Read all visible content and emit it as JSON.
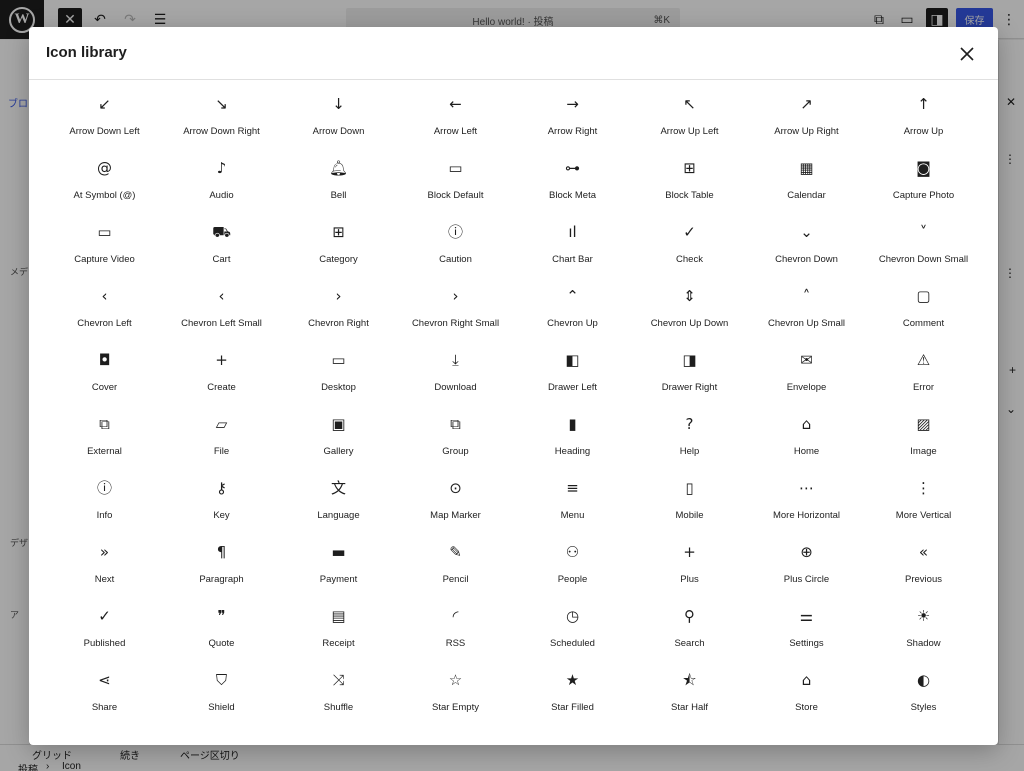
{
  "editor": {
    "wp_logo": "W",
    "doc_title": "Hello world! · 投稿",
    "shortcut": "⌘K",
    "save_label": "保存",
    "left_tab": "ブロ",
    "left_labels": [
      "メデ",
      "デザ",
      "ア"
    ],
    "bottom_tabs": [
      "グリッド",
      "続き",
      "ページ区切り"
    ],
    "breadcrumb": [
      "投稿",
      "›",
      "Icon"
    ]
  },
  "modal": {
    "title": "Icon library",
    "icons": [
      {
        "label": "Arrow Down Left",
        "glyph": "↙"
      },
      {
        "label": "Arrow Down Right",
        "glyph": "↘"
      },
      {
        "label": "Arrow Down",
        "glyph": "↓"
      },
      {
        "label": "Arrow Left",
        "glyph": "←"
      },
      {
        "label": "Arrow Right",
        "glyph": "→"
      },
      {
        "label": "Arrow Up Left",
        "glyph": "↖"
      },
      {
        "label": "Arrow Up Right",
        "glyph": "↗"
      },
      {
        "label": "Arrow Up",
        "glyph": "↑"
      },
      {
        "label": "At Symbol (@)",
        "glyph": "@"
      },
      {
        "label": "Audio",
        "glyph": "♪"
      },
      {
        "label": "Bell",
        "glyph": "🔔︎"
      },
      {
        "label": "Block Default",
        "glyph": "▭"
      },
      {
        "label": "Block Meta",
        "glyph": "⊶"
      },
      {
        "label": "Block Table",
        "glyph": "⊞"
      },
      {
        "label": "Calendar",
        "glyph": "▦"
      },
      {
        "label": "Capture Photo",
        "glyph": "◙"
      },
      {
        "label": "Capture Video",
        "glyph": "▭"
      },
      {
        "label": "Cart",
        "glyph": "⛟"
      },
      {
        "label": "Category",
        "glyph": "⊞"
      },
      {
        "label": "Caution",
        "glyph": "ⓘ"
      },
      {
        "label": "Chart Bar",
        "glyph": "ıl"
      },
      {
        "label": "Check",
        "glyph": "✓"
      },
      {
        "label": "Chevron Down",
        "glyph": "⌄"
      },
      {
        "label": "Chevron Down Small",
        "glyph": "˅"
      },
      {
        "label": "Chevron Left",
        "glyph": "‹"
      },
      {
        "label": "Chevron Left Small",
        "glyph": "‹"
      },
      {
        "label": "Chevron Right",
        "glyph": "›"
      },
      {
        "label": "Chevron Right Small",
        "glyph": "›"
      },
      {
        "label": "Chevron Up",
        "glyph": "⌃"
      },
      {
        "label": "Chevron Up Down",
        "glyph": "⇕"
      },
      {
        "label": "Chevron Up Small",
        "glyph": "˄"
      },
      {
        "label": "Comment",
        "glyph": "▢"
      },
      {
        "label": "Cover",
        "glyph": "◘"
      },
      {
        "label": "Create",
        "glyph": "+"
      },
      {
        "label": "Desktop",
        "glyph": "▭"
      },
      {
        "label": "Download",
        "glyph": "⤓"
      },
      {
        "label": "Drawer Left",
        "glyph": "◧"
      },
      {
        "label": "Drawer Right",
        "glyph": "◨"
      },
      {
        "label": "Envelope",
        "glyph": "✉"
      },
      {
        "label": "Error",
        "glyph": "⚠"
      },
      {
        "label": "External",
        "glyph": "⧉"
      },
      {
        "label": "File",
        "glyph": "▱"
      },
      {
        "label": "Gallery",
        "glyph": "▣"
      },
      {
        "label": "Group",
        "glyph": "⧉"
      },
      {
        "label": "Heading",
        "glyph": "▮"
      },
      {
        "label": "Help",
        "glyph": "?"
      },
      {
        "label": "Home",
        "glyph": "⌂"
      },
      {
        "label": "Image",
        "glyph": "▨"
      },
      {
        "label": "Info",
        "glyph": "ⓘ"
      },
      {
        "label": "Key",
        "glyph": "⚷"
      },
      {
        "label": "Language",
        "glyph": "文"
      },
      {
        "label": "Map Marker",
        "glyph": "⊙"
      },
      {
        "label": "Menu",
        "glyph": "≡"
      },
      {
        "label": "Mobile",
        "glyph": "▯"
      },
      {
        "label": "More Horizontal",
        "glyph": "⋯"
      },
      {
        "label": "More Vertical",
        "glyph": "⋮"
      },
      {
        "label": "Next",
        "glyph": "»"
      },
      {
        "label": "Paragraph",
        "glyph": "¶"
      },
      {
        "label": "Payment",
        "glyph": "▬"
      },
      {
        "label": "Pencil",
        "glyph": "✎"
      },
      {
        "label": "People",
        "glyph": "⚇"
      },
      {
        "label": "Plus",
        "glyph": "+"
      },
      {
        "label": "Plus Circle",
        "glyph": "⊕"
      },
      {
        "label": "Previous",
        "glyph": "«"
      },
      {
        "label": "Published",
        "glyph": "✓"
      },
      {
        "label": "Quote",
        "glyph": "❞"
      },
      {
        "label": "Receipt",
        "glyph": "▤"
      },
      {
        "label": "RSS",
        "glyph": "◜"
      },
      {
        "label": "Scheduled",
        "glyph": "◷"
      },
      {
        "label": "Search",
        "glyph": "⚲"
      },
      {
        "label": "Settings",
        "glyph": "⚌"
      },
      {
        "label": "Shadow",
        "glyph": "☀"
      },
      {
        "label": "Share",
        "glyph": "⋖"
      },
      {
        "label": "Shield",
        "glyph": "⛉"
      },
      {
        "label": "Shuffle",
        "glyph": "⤨"
      },
      {
        "label": "Star Empty",
        "glyph": "☆"
      },
      {
        "label": "Star Filled",
        "glyph": "★"
      },
      {
        "label": "Star Half",
        "glyph": "⯪"
      },
      {
        "label": "Store",
        "glyph": "⌂"
      },
      {
        "label": "Styles",
        "glyph": "◐"
      }
    ]
  }
}
